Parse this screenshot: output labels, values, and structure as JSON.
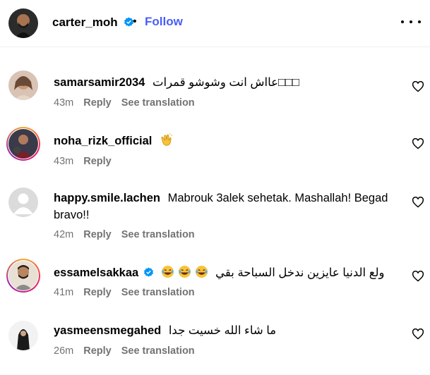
{
  "header": {
    "username": "carter_moh",
    "separator": "•",
    "follow_label": "Follow",
    "more_icon": "more-horizontal-icon"
  },
  "comments": [
    {
      "username": "samarsamir2034",
      "text": "عااش انت وشوشو قمرات□□□",
      "time": "43m",
      "reply": "Reply",
      "translate": "See translation",
      "story_ring": false
    },
    {
      "username": "noha_rizk_official",
      "text": "",
      "emoji": "clapping-hands-emoji",
      "time": "43m",
      "reply": "Reply",
      "story_ring": true
    },
    {
      "username": "happy.smile.lachen",
      "text": "Mabrouk 3alek sehetak. Mashallah! Begad bravo!!",
      "time": "42m",
      "reply": "Reply",
      "translate": "See translation",
      "story_ring": false
    },
    {
      "username": "essamelsakkaa",
      "verified": true,
      "text": "ولع الدنيا عايزين ندخل السباحة بقي",
      "emoji": "laughing-tears-emoji",
      "time": "41m",
      "reply": "Reply",
      "translate": "See translation",
      "story_ring": true
    },
    {
      "username": "yasmeensmegahed",
      "text": "ما شاء الله خسيت جدا",
      "time": "26m",
      "reply": "Reply",
      "translate": "See translation",
      "story_ring": false
    }
  ],
  "colors": {
    "follow": "#4a5df9",
    "meta": "#737373",
    "verified": "#0095f6"
  }
}
